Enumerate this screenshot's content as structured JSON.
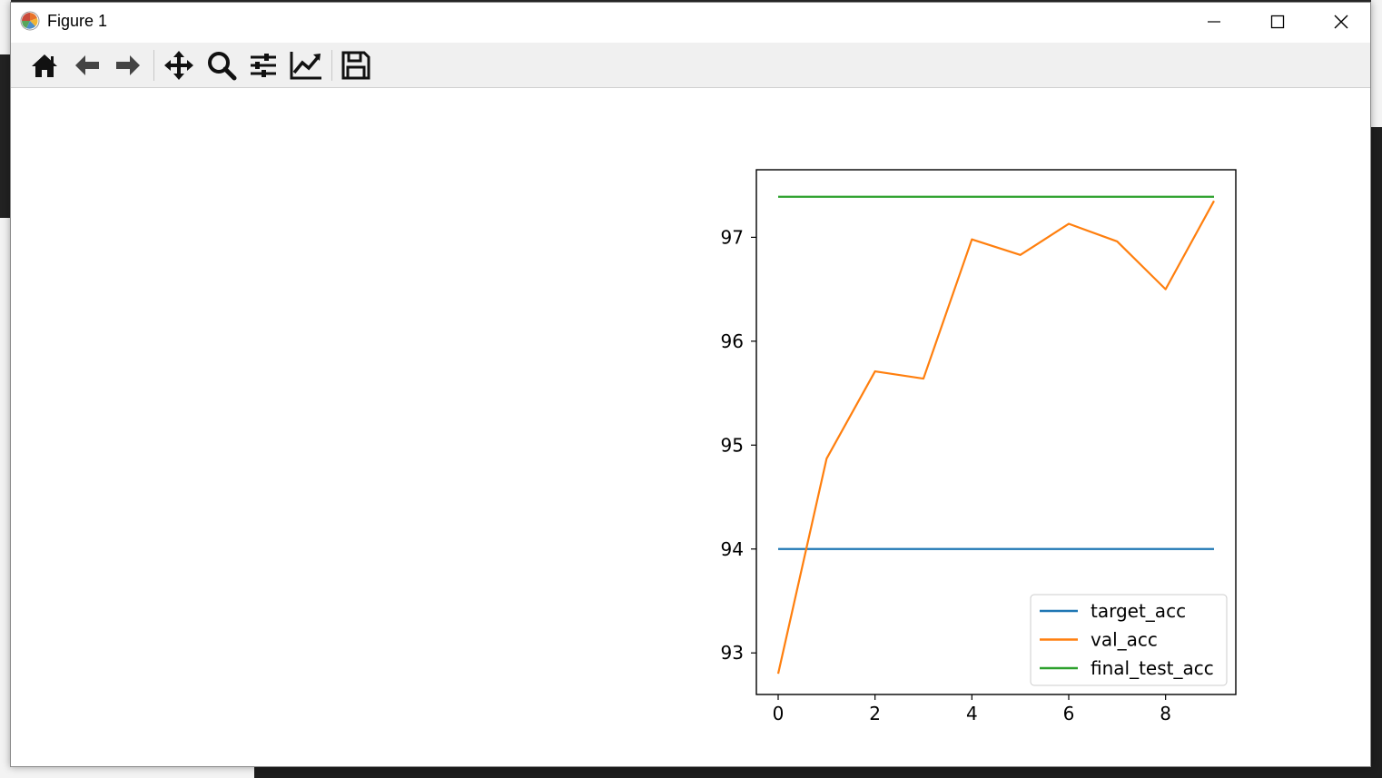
{
  "window": {
    "title": "Figure 1"
  },
  "toolbar": {
    "tools": [
      "home-icon",
      "back-arrow-icon",
      "forward-arrow-icon",
      "pan-icon",
      "zoom-icon",
      "configure-subplots-icon",
      "edit-axis-icon",
      "save-icon"
    ]
  },
  "chart_data": {
    "type": "line",
    "title": "",
    "xlabel": "",
    "ylabel": "",
    "xlim": [
      -0.45,
      9.45
    ],
    "ylim": [
      92.6,
      97.65
    ],
    "x_ticks": [
      "0",
      "2",
      "4",
      "6",
      "8"
    ],
    "y_ticks": [
      "93",
      "94",
      "95",
      "96",
      "97"
    ],
    "legend_position": "lower-right",
    "x": [
      0,
      1,
      2,
      3,
      4,
      5,
      6,
      7,
      8,
      9
    ],
    "series": [
      {
        "name": "target_acc",
        "color": "#1f77b4",
        "values": [
          94.0,
          94.0,
          94.0,
          94.0,
          94.0,
          94.0,
          94.0,
          94.0,
          94.0,
          94.0
        ]
      },
      {
        "name": "val_acc",
        "color": "#ff7f0e",
        "values": [
          92.8,
          94.87,
          95.71,
          95.64,
          96.98,
          96.83,
          97.13,
          96.96,
          96.5,
          97.35
        ]
      },
      {
        "name": "final_test_acc",
        "color": "#2ca02c",
        "values": [
          97.39,
          97.39,
          97.39,
          97.39,
          97.39,
          97.39,
          97.39,
          97.39,
          97.39,
          97.39
        ]
      }
    ]
  }
}
